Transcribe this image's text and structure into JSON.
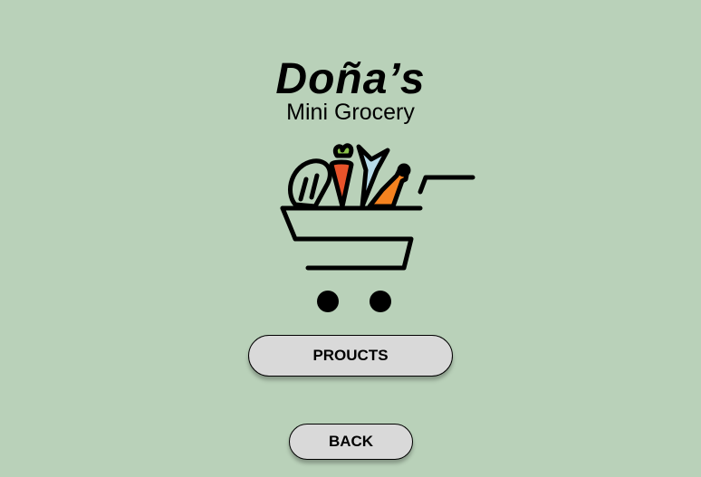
{
  "brand": {
    "title": "Doña’s",
    "subtitle": "Mini Grocery",
    "logo_icon": "grocery-cart-icon"
  },
  "buttons": {
    "products_label": "PROUCTS",
    "back_label": "BACK"
  },
  "colors": {
    "background": "#b9d1b9",
    "button_fill": "#d9d9d9",
    "carrot": "#e8532a",
    "carrot_leaf": "#8bc34a",
    "chicken": "#f5821f",
    "fish": "#b7dbe9"
  }
}
